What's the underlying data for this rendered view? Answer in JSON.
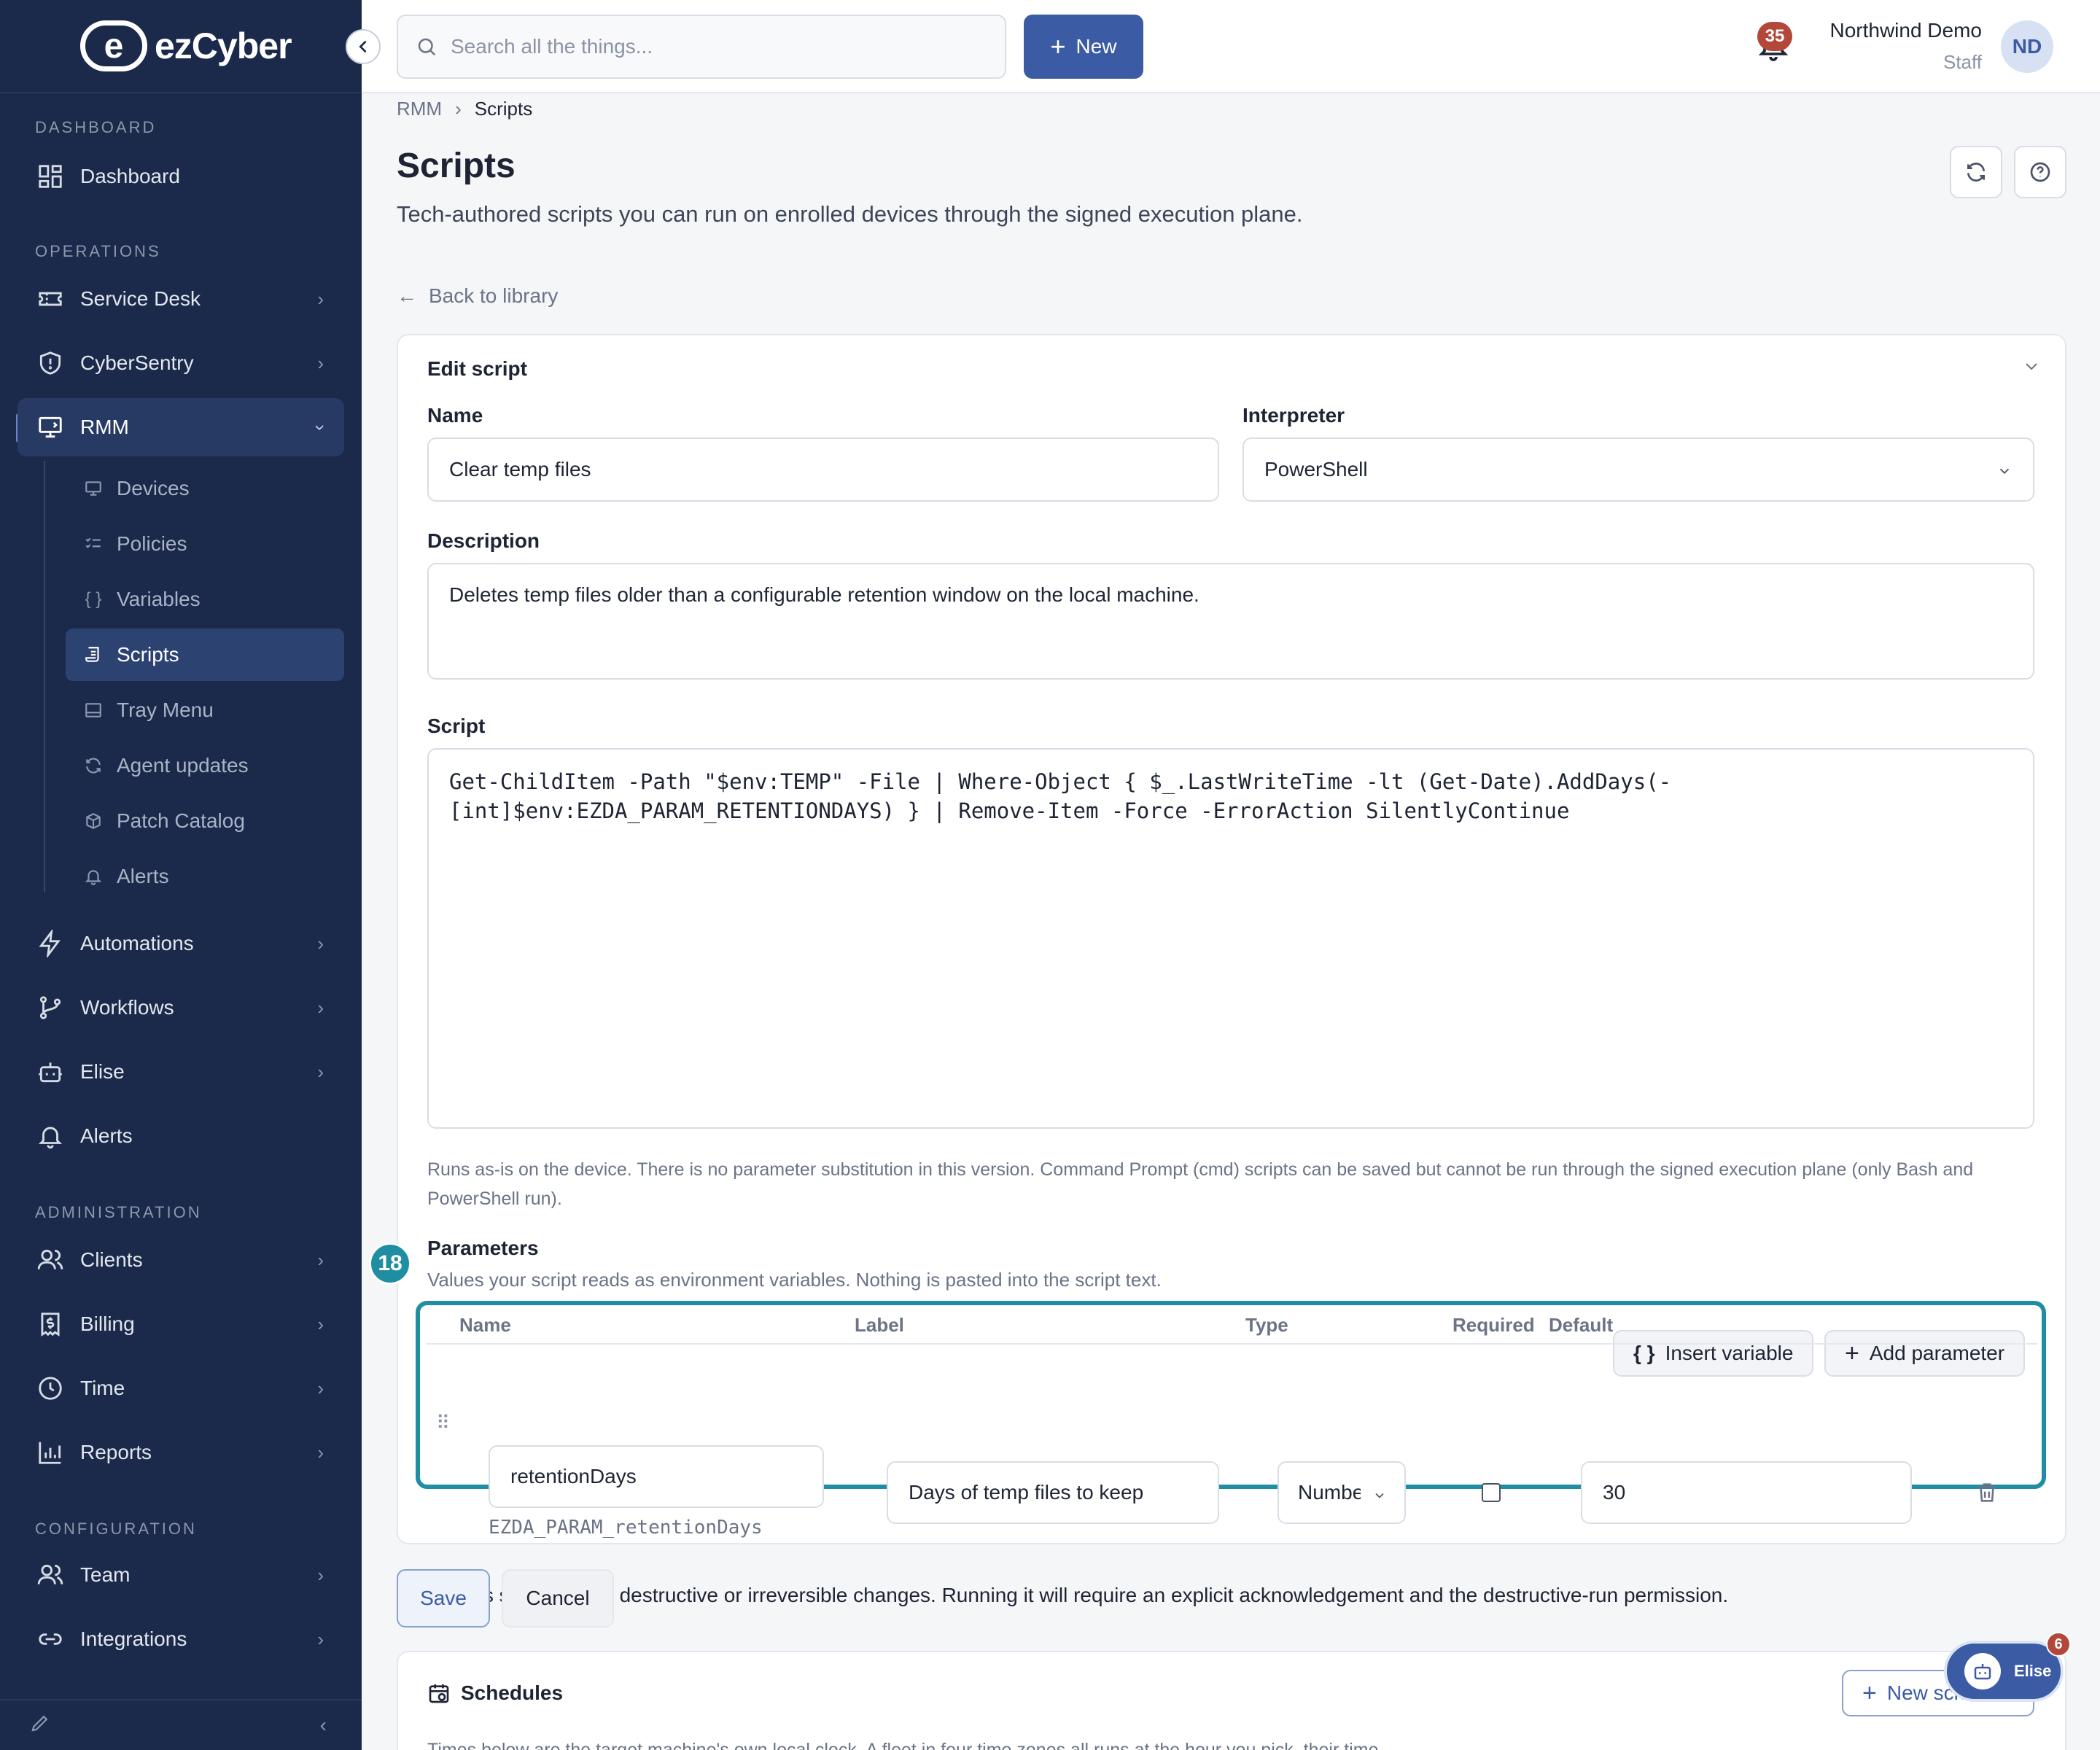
{
  "brand": {
    "name": "ezCyber",
    "logo_letter": "e"
  },
  "sidebar": {
    "sections": {
      "dashboard": "DASHBOARD",
      "operations": "OPERATIONS",
      "administration": "ADMINISTRATION",
      "configuration": "CONFIGURATION"
    },
    "items": {
      "dashboard": "Dashboard",
      "service_desk": "Service Desk",
      "cybersentry": "CyberSentry",
      "rmm": "RMM",
      "automations": "Automations",
      "workflows": "Workflows",
      "elise": "Elise",
      "alerts": "Alerts",
      "clients": "Clients",
      "billing": "Billing",
      "time": "Time",
      "reports": "Reports",
      "team": "Team",
      "integrations": "Integrations"
    },
    "rmm_sub": {
      "devices": "Devices",
      "policies": "Policies",
      "variables": "Variables",
      "scripts": "Scripts",
      "tray_menu": "Tray Menu",
      "agent_updates": "Agent updates",
      "patch_catalog": "Patch Catalog",
      "alerts": "Alerts"
    }
  },
  "topbar": {
    "search_placeholder": "Search all the things...",
    "new_label": "New",
    "notifications_count": "35",
    "user_name": "Northwind Demo",
    "user_role": "Staff",
    "user_initials": "ND"
  },
  "breadcrumb": {
    "parent": "RMM",
    "current": "Scripts"
  },
  "page": {
    "title": "Scripts",
    "subtitle": "Tech-authored scripts you can run on enrolled devices through the signed execution plane.",
    "back_label": "Back to library"
  },
  "editor": {
    "card_title": "Edit script",
    "name_label": "Name",
    "name_value": "Clear temp files",
    "interpreter_label": "Interpreter",
    "interpreter_value": "PowerShell",
    "description_label": "Description",
    "description_value": "Deletes temp files older than a configurable retention window on the local machine.",
    "script_label": "Script",
    "script_value": "Get-ChildItem -Path \"$env:TEMP\" -File | Where-Object { $_.LastWriteTime -lt (Get-Date).AddDays(-\n[int]$env:EZDA_PARAM_RETENTIONDAYS) } | Remove-Item -Force -ErrorAction SilentlyContinue",
    "hint": "Runs as-is on the device. There is no parameter substitution in this version. Command Prompt (cmd) scripts can be saved but cannot be run through the signed execution plane (only Bash and PowerShell run).",
    "params_title": "Parameters",
    "params_sub": "Values your script reads as environment variables. Nothing is pasted into the script text.",
    "insert_variable_label": "Insert variable",
    "add_parameter_label": "Add parameter",
    "step_badge": "18",
    "columns": {
      "name": "Name",
      "label": "Label",
      "type": "Type",
      "required": "Required",
      "default": "Default"
    },
    "parameters": [
      {
        "name": "retentionDays",
        "env_var": "EZDA_PARAM_retentionDays",
        "label": "Days of temp files to keep",
        "type": "Number",
        "required": false,
        "default": "30"
      }
    ],
    "destructive_label": "This script makes destructive or irreversible changes. Running it will require an explicit acknowledgement and the destructive-run permission.",
    "save_label": "Save",
    "cancel_label": "Cancel"
  },
  "schedules": {
    "title": "Schedules",
    "new_label": "New schedule",
    "sub": "Times below are the target machine's own local clock. A fleet in four time zones all runs at the hour you pick, their time."
  },
  "assistant": {
    "label": "Elise",
    "badge": "6"
  },
  "colors": {
    "sidebar": "#1b2a4a",
    "accent": "#3b5ba5",
    "highlight": "#1f8ea3",
    "badge": "#b2473a"
  }
}
